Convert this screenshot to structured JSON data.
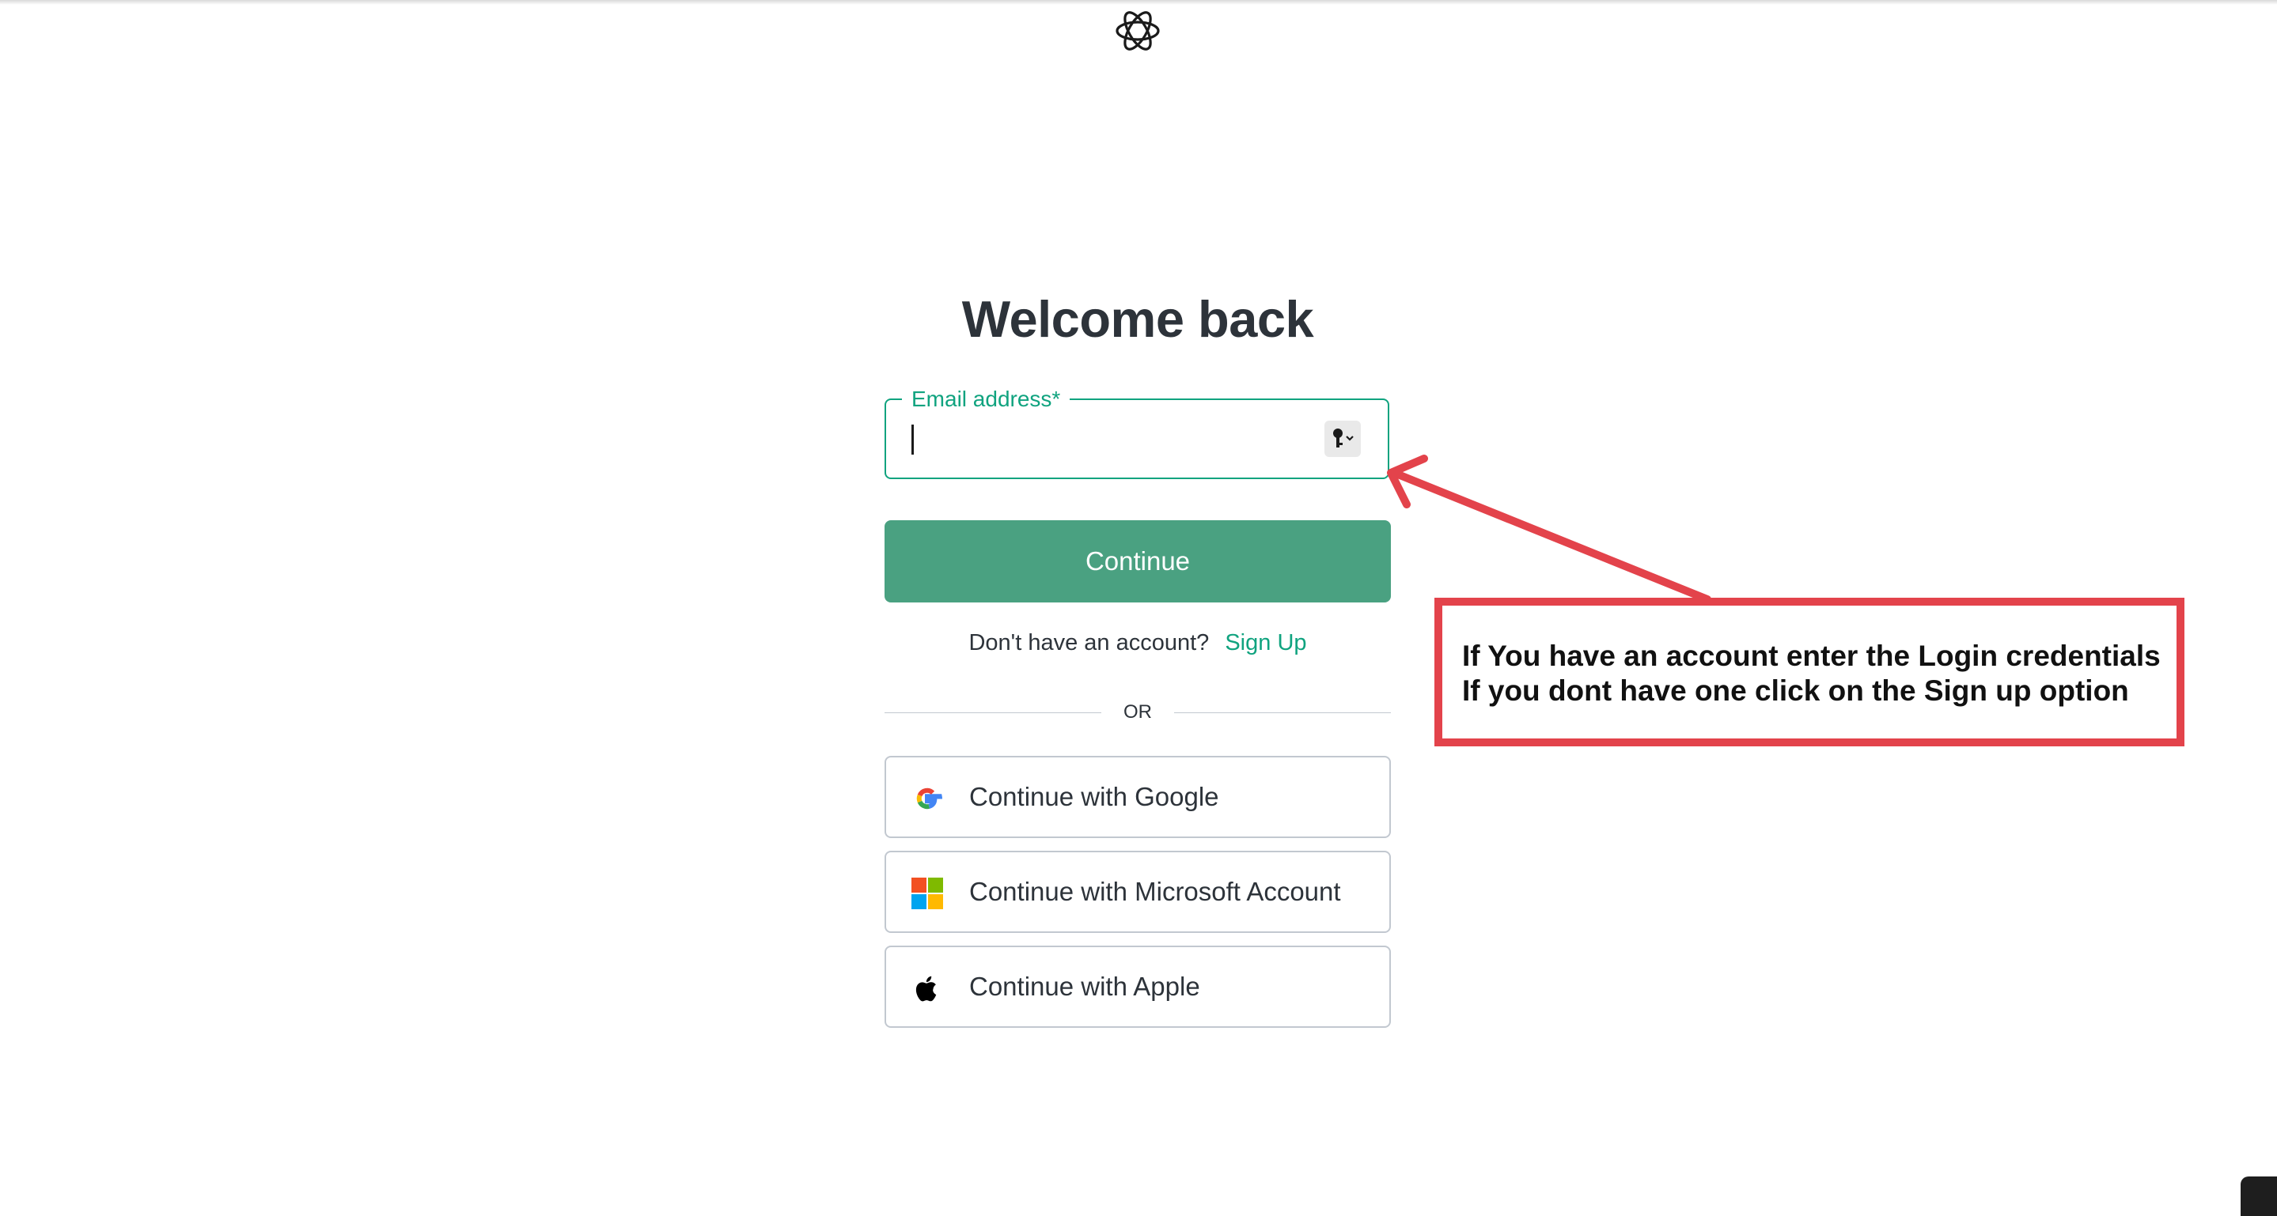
{
  "header": {
    "logo_icon": "openai-logo-icon"
  },
  "main": {
    "title": "Welcome back",
    "email": {
      "label": "Email address*",
      "value": "",
      "password_manager_icon": "key-icon"
    },
    "continue_label": "Continue",
    "signup_prompt": "Don't have an account?",
    "signup_link": "Sign Up",
    "divider_text": "OR",
    "social_buttons": [
      {
        "label": "Continue with Google",
        "icon": "google-icon"
      },
      {
        "label": "Continue with Microsoft Account",
        "icon": "microsoft-icon"
      },
      {
        "label": "Continue with Apple",
        "icon": "apple-icon"
      }
    ]
  },
  "annotation": {
    "line1": "If You have an account enter the Login credentials",
    "line2": "If you dont have one click on the Sign up option",
    "color": "#e3434b"
  },
  "colors": {
    "accent": "#10a37f",
    "button": "#4aa181"
  }
}
